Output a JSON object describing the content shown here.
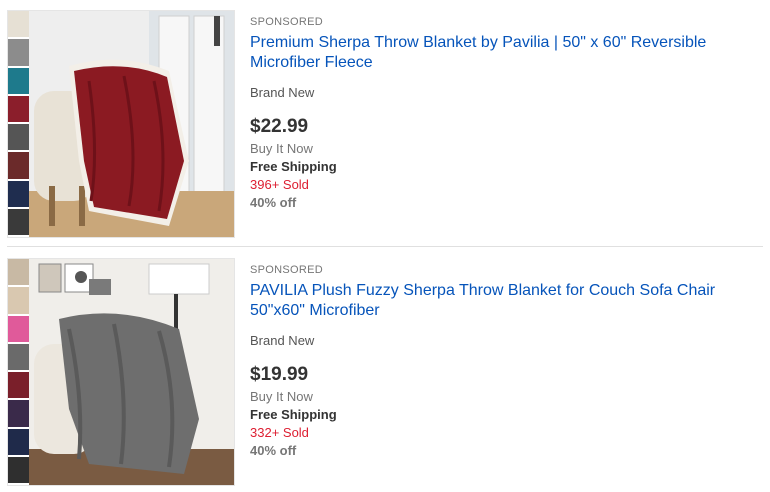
{
  "listings": [
    {
      "sponsored_label": "SPONSORED",
      "title": "Premium Sherpa Throw Blanket by Pavilia | 50\" x 60\" Reversible Microfiber Fleece",
      "condition": "Brand New",
      "price": "$22.99",
      "format": "Buy It Now",
      "shipping": "Free Shipping",
      "sold": "396+ Sold",
      "discount": "40% off",
      "swatch_colors": [
        "#e6e0d4",
        "#8c8c8c",
        "#1e7a8c",
        "#8b1e2b",
        "#555555",
        "#6b2a2a",
        "#1f2d4f",
        "#3a3a3a"
      ],
      "blanket_color": "#8b1a22"
    },
    {
      "sponsored_label": "SPONSORED",
      "title": "PAVILIA Plush Fuzzy Sherpa Throw Blanket for Couch Sofa Chair 50\"x60\" Microfiber",
      "condition": "Brand New",
      "price": "$19.99",
      "format": "Buy It Now",
      "shipping": "Free Shipping",
      "sold": "332+ Sold",
      "discount": "40% off",
      "swatch_colors": [
        "#c8b9a4",
        "#d9c8b0",
        "#e05a9a",
        "#6a6a6a",
        "#7a1f2a",
        "#3a2a4a",
        "#1f2a4a",
        "#2f2f2f"
      ],
      "blanket_color": "#6e6e6e"
    }
  ]
}
